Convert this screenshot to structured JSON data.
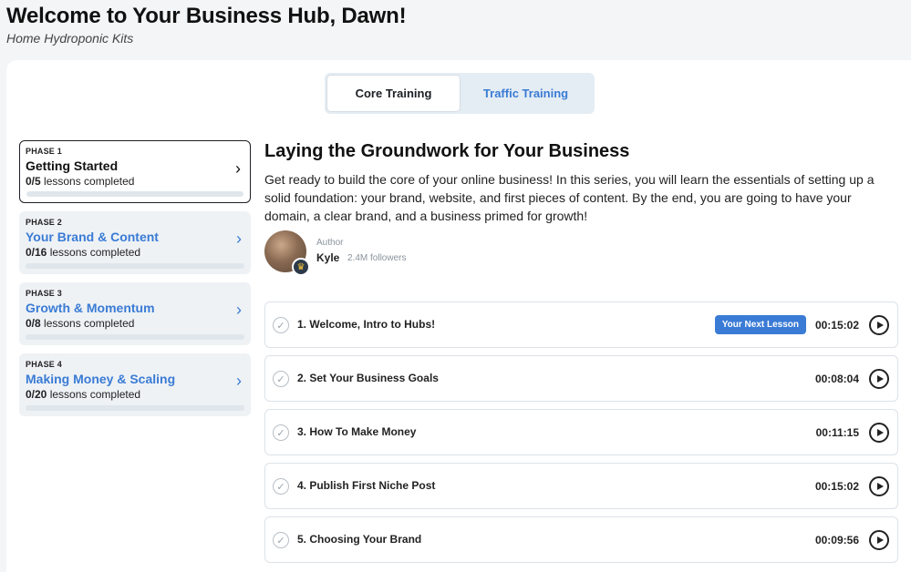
{
  "header": {
    "title": "Welcome to Your Business Hub, Dawn!",
    "subtitle": "Home Hydroponic Kits"
  },
  "tabs": [
    {
      "label": "Core Training",
      "active": true
    },
    {
      "label": "Traffic Training",
      "active": false
    }
  ],
  "phases": [
    {
      "number": "PHASE 1",
      "name": "Getting Started",
      "completed": "0/5",
      "suffix": "lessons completed",
      "progress": 0,
      "active": true
    },
    {
      "number": "PHASE 2",
      "name": "Your Brand & Content",
      "completed": "0/16",
      "suffix": "lessons completed",
      "progress": 0,
      "active": false
    },
    {
      "number": "PHASE 3",
      "name": "Growth & Momentum",
      "completed": "0/8",
      "suffix": "lessons completed",
      "progress": 0,
      "active": false
    },
    {
      "number": "PHASE 4",
      "name": "Making Money & Scaling",
      "completed": "0/20",
      "suffix": "lessons completed",
      "progress": 0,
      "active": false
    }
  ],
  "section": {
    "title": "Laying the Groundwork for Your Business",
    "description": "Get ready to build the core of your online business! In this series, you will learn the essentials of setting up a solid foundation: your brand, website, and first pieces of content. By the end, you are going to have your domain, a clear brand, and a business primed for growth!"
  },
  "author": {
    "label": "Author",
    "name": "Kyle",
    "followers": "2.4M followers",
    "badge_icon": "crown-icon"
  },
  "lessons": [
    {
      "title": "1. Welcome, Intro to Hubs!",
      "duration": "00:15:02",
      "badge": "Your Next Lesson"
    },
    {
      "title": "2. Set Your Business Goals",
      "duration": "00:08:04"
    },
    {
      "title": "3. How To Make Money",
      "duration": "00:11:15"
    },
    {
      "title": "4. Publish First Niche Post",
      "duration": "00:15:02"
    },
    {
      "title": "5. Choosing Your Brand",
      "duration": "00:09:56"
    }
  ],
  "colors": {
    "accent": "#3a7bd5",
    "text": "#1c1f24",
    "background": "#f4f5f7"
  }
}
